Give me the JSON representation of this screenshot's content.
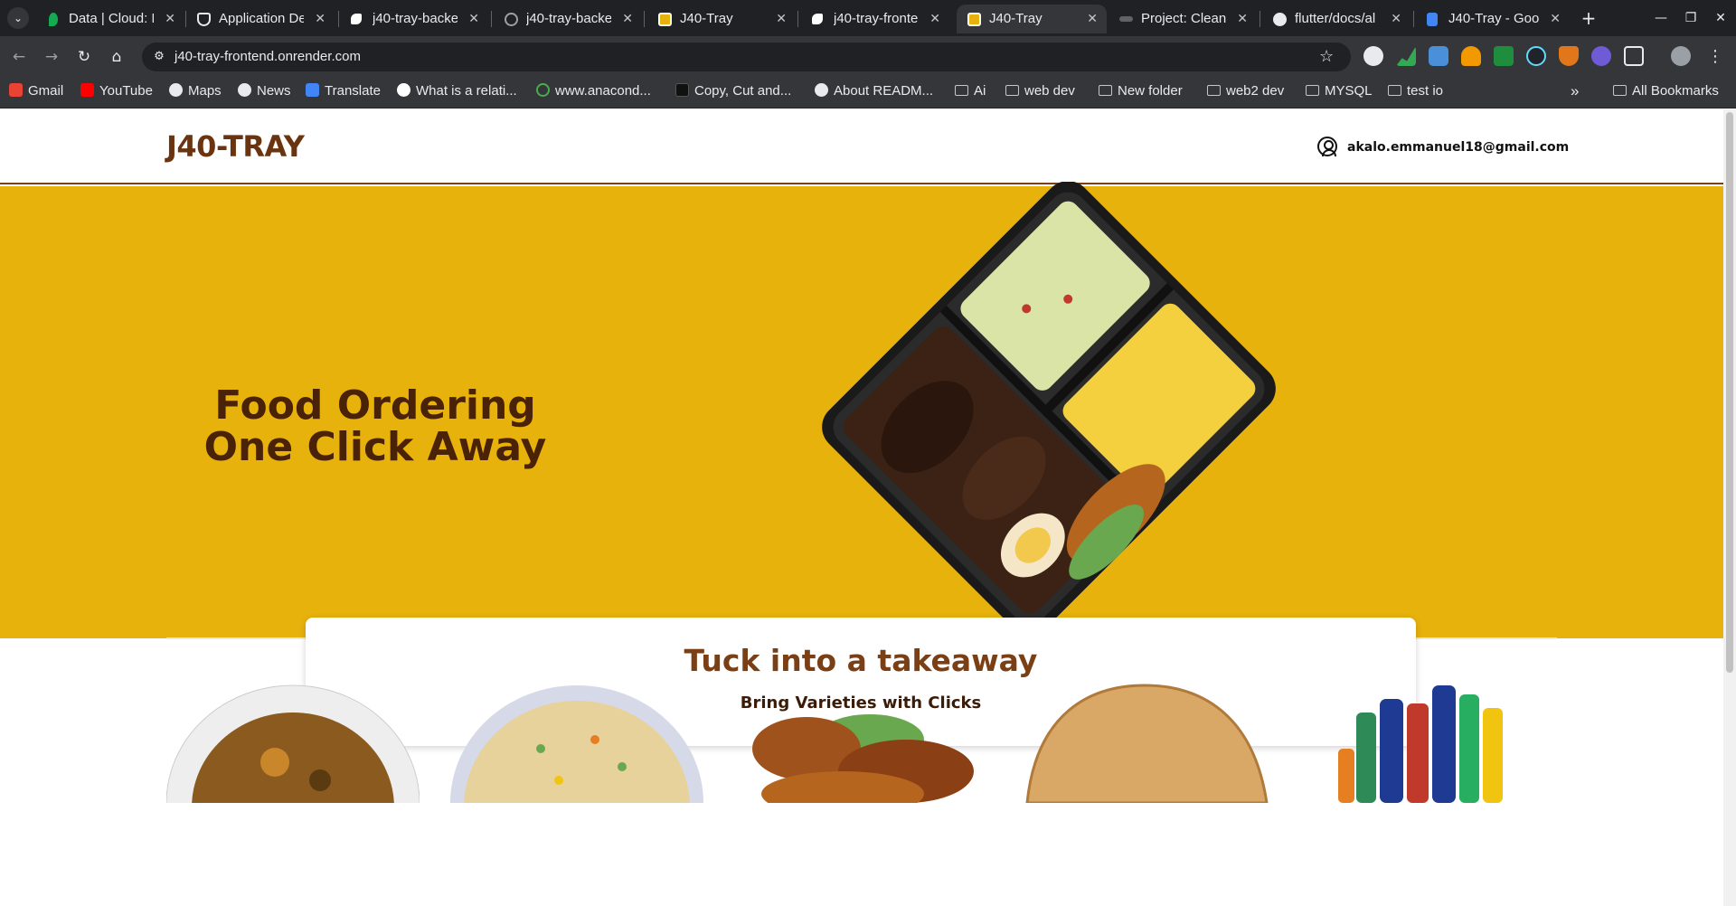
{
  "browser": {
    "tabs": [
      {
        "title": "Data | Cloud: M",
        "icon": "leaf-icon",
        "color": "#13aa52",
        "active": false
      },
      {
        "title": "Application De",
        "icon": "shield-icon",
        "color": "#e8eaed",
        "active": false
      },
      {
        "title": "j40-tray-backe",
        "icon": "render-icon",
        "color": "#ffffff",
        "active": false
      },
      {
        "title": "j40-tray-backe",
        "icon": "globe-icon",
        "color": "#9aa0a6",
        "active": false
      },
      {
        "title": "J40-Tray",
        "icon": "tray-favicon",
        "color": "#e8b20c",
        "active": false
      },
      {
        "title": "j40-tray-fronte",
        "icon": "render-icon",
        "color": "#ffffff",
        "active": false
      },
      {
        "title": "J40-Tray",
        "icon": "tray-favicon",
        "color": "#e8b20c",
        "active": true
      },
      {
        "title": "Project: Clean",
        "icon": "project-icon",
        "color": "#9aa0a6",
        "active": false
      },
      {
        "title": "flutter/docs/al",
        "icon": "github-icon",
        "color": "#e8eaed",
        "active": false
      },
      {
        "title": "J40-Tray - Goo",
        "icon": "docs-icon",
        "color": "#4285f4",
        "active": false
      }
    ],
    "url": "j40-tray-frontend.onrender.com",
    "bookmarks": [
      {
        "label": "Gmail",
        "icon": "gmail-icon",
        "color": "#ea4335"
      },
      {
        "label": "YouTube",
        "icon": "youtube-icon",
        "color": "#ff0000"
      },
      {
        "label": "Maps",
        "icon": "globe-icon",
        "color": "#e8eaed"
      },
      {
        "label": "News",
        "icon": "globe-icon",
        "color": "#e8eaed"
      },
      {
        "label": "Translate",
        "icon": "translate-icon",
        "color": "#4285f4"
      },
      {
        "label": "What is a relati...",
        "icon": "google-icon",
        "color": "#ffffff"
      },
      {
        "label": "www.anacond...",
        "icon": "anaconda-icon",
        "color": "#43b049"
      },
      {
        "label": "Copy, Cut and...",
        "icon": "hex-icon",
        "color": "#111111"
      },
      {
        "label": "About READM...",
        "icon": "github-icon",
        "color": "#e8eaed"
      },
      {
        "label": "Ai",
        "icon": "folder-icon"
      },
      {
        "label": "web dev",
        "icon": "folder-icon"
      },
      {
        "label": "New folder",
        "icon": "folder-icon"
      },
      {
        "label": "web2 dev",
        "icon": "folder-icon"
      },
      {
        "label": "MYSQL",
        "icon": "folder-icon"
      },
      {
        "label": "test io",
        "icon": "folder-icon"
      }
    ],
    "more_bookmarks": "»",
    "all_bookmarks": "All Bookmarks"
  },
  "site": {
    "logo": "J40-TRAY",
    "user_email": "akalo.emmanuel18@gmail.com",
    "hero_title_line1": "Food Ordering",
    "hero_title_line2": "One Click Away",
    "card_title": "Tuck into a takeaway",
    "card_subtitle": "Bring Varieties with Clicks",
    "food_items": [
      {
        "name": "egusi-soup-image"
      },
      {
        "name": "fried-rice-image"
      },
      {
        "name": "grilled-chicken-image"
      },
      {
        "name": "meat-pie-image"
      },
      {
        "name": "soft-drinks-image"
      }
    ],
    "colors": {
      "hero_bg": "#e8b20c",
      "brand_brown": "#6b3410"
    }
  }
}
